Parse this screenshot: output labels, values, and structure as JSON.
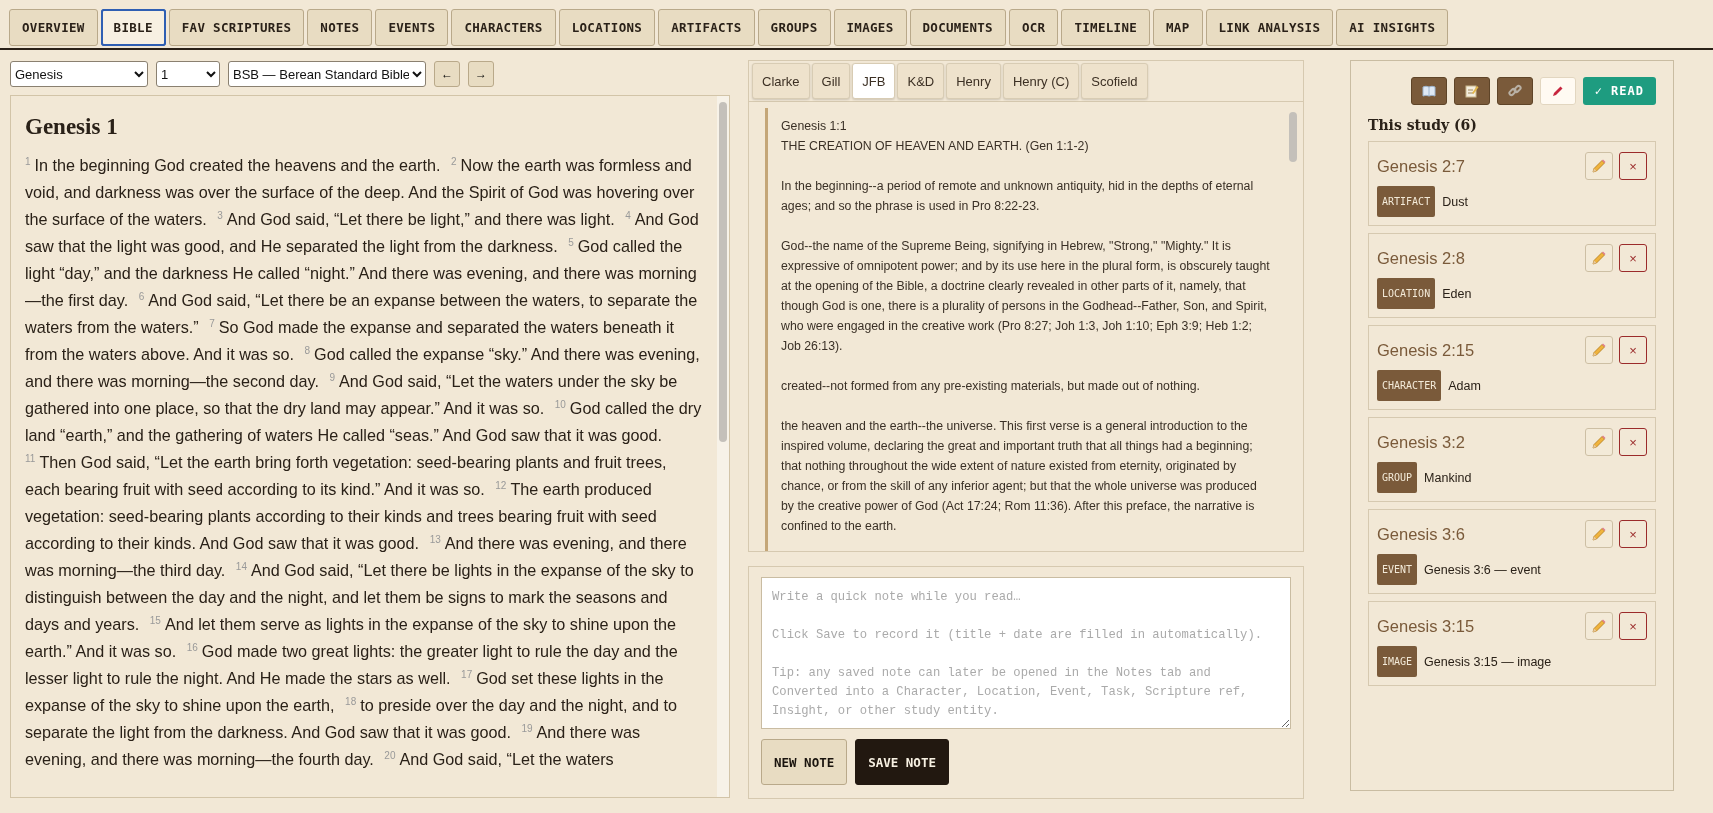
{
  "main_tabs": [
    {
      "label": "OVERVIEW",
      "selected": false
    },
    {
      "label": "BIBLE",
      "selected": true
    },
    {
      "label": "FAV SCRIPTURES",
      "selected": false
    },
    {
      "label": "NOTES",
      "selected": false
    },
    {
      "label": "EVENTS",
      "selected": false
    },
    {
      "label": "CHARACTERS",
      "selected": false
    },
    {
      "label": "LOCATIONS",
      "selected": false
    },
    {
      "label": "ARTIFACTS",
      "selected": false
    },
    {
      "label": "GROUPS",
      "selected": false
    },
    {
      "label": "IMAGES",
      "selected": false
    },
    {
      "label": "DOCUMENTS",
      "selected": false
    },
    {
      "label": "OCR",
      "selected": false
    },
    {
      "label": "TIMELINE",
      "selected": false
    },
    {
      "label": "MAP",
      "selected": false
    },
    {
      "label": "LINK ANALYSIS",
      "selected": false
    },
    {
      "label": "AI INSIGHTS",
      "selected": false
    }
  ],
  "toolbar": {
    "book": "Genesis",
    "chapter": "1",
    "translation": "BSB — Berean Standard Bible",
    "prev_button": "←",
    "next_button": "→"
  },
  "passage": {
    "title": "Genesis 1",
    "verses": [
      {
        "number": "1",
        "text": "In the beginning God created the heavens and the earth."
      },
      {
        "number": "2",
        "text": "Now the earth was formless and void, and darkness was over the surface of the deep. And the Spirit of God was hovering over the surface of the waters."
      },
      {
        "number": "3",
        "text": "And God said, “Let there be light,” and there was light."
      },
      {
        "number": "4",
        "text": "And God saw that the light was good, and He separated the light from the darkness."
      },
      {
        "number": "5",
        "text": "God called the light “day,” and the darkness He called “night.” And there was evening, and there was morning—the first day."
      },
      {
        "number": "6",
        "text": "And God said, “Let there be an expanse between the waters, to separate the waters from the waters.”"
      },
      {
        "number": "7",
        "text": "So God made the expanse and separated the waters beneath it from the waters above. And it was so."
      },
      {
        "number": "8",
        "text": "God called the expanse “sky.” And there was evening, and there was morning—the second day."
      },
      {
        "number": "9",
        "text": "And God said, “Let the waters under the sky be gathered into one place, so that the dry land may appear.” And it was so."
      },
      {
        "number": "10",
        "text": "God called the dry land “earth,” and the gathering of waters He called “seas.” And God saw that it was good."
      },
      {
        "number": "11",
        "text": "Then God said, “Let the earth bring forth vegetation: seed-bearing plants and fruit trees, each bearing fruit with seed according to its kind.” And it was so."
      },
      {
        "number": "12",
        "text": "The earth produced vegetation: seed-bearing plants according to their kinds and trees bearing fruit with seed according to their kinds. And God saw that it was good."
      },
      {
        "number": "13",
        "text": "And there was evening, and there was morning—the third day."
      },
      {
        "number": "14",
        "text": "And God said, “Let there be lights in the expanse of the sky to distinguish between the day and the night, and let them be signs to mark the seasons and days and years."
      },
      {
        "number": "15",
        "text": "And let them serve as lights in the expanse of the sky to shine upon the earth.” And it was so."
      },
      {
        "number": "16",
        "text": "God made two great lights: the greater light to rule the day and the lesser light to rule the night. And He made the stars as well."
      },
      {
        "number": "17",
        "text": "God set these lights in the expanse of the sky to shine upon the earth,"
      },
      {
        "number": "18",
        "text": "to preside over the day and the night, and to separate the light from the darkness. And God saw that it was good."
      },
      {
        "number": "19",
        "text": "And there was evening, and there was morning—the fourth day."
      },
      {
        "number": "20",
        "text": "And God said, “Let the waters"
      }
    ]
  },
  "commentary": {
    "tabs": [
      {
        "label": "Clarke",
        "selected": false
      },
      {
        "label": "Gill",
        "selected": false
      },
      {
        "label": "JFB",
        "selected": true
      },
      {
        "label": "K&D",
        "selected": false
      },
      {
        "label": "Henry",
        "selected": false
      },
      {
        "label": "Henry (C)",
        "selected": false
      },
      {
        "label": "Scofield",
        "selected": false
      }
    ],
    "reference": "Genesis 1:1",
    "heading": "THE CREATION OF HEAVEN AND EARTH. (Gen 1:1-2)",
    "paragraphs": [
      "In the beginning--a period of remote and unknown antiquity, hid in the depths of eternal ages; and so the phrase is used in Pro 8:22-23.",
      "God--the name of the Supreme Being, signifying in Hebrew, \"Strong,\" \"Mighty.\" It is expressive of omnipotent power; and by its use here in the plural form, is obscurely taught at the opening of the Bible, a doctrine clearly revealed in other parts of it, namely, that though God is one, there is a plurality of persons in the Godhead--Father, Son, and Spirit, who were engaged in the creative work (Pro 8:27; Joh 1:3, Joh 1:10; Eph 3:9; Heb 1:2; Job 26:13).",
      "created--not formed from any pre-existing materials, but made out of nothing.",
      "the heaven and the earth--the universe. This first verse is a general introduction to the inspired volume, declaring the great and important truth that all things had a beginning; that nothing throughout the wide extent of nature existed from eternity, originated by chance, or from the skill of any inferior agent; but that the whole universe was produced by the creative power of God (Act 17:24; Rom 11:36). After this preface, the narrative is confined to the earth."
    ]
  },
  "note_editor": {
    "placeholder": "Write a quick note while you read…\n\nClick Save to record it (title + date are filled in automatically).\n\nTip: any saved note can later be opened in the Notes tab and\nConverted into a Character, Location, Event, Task, Scripture ref,\nInsight, or other study entity.",
    "buttons": [
      {
        "label": "NEW NOTE",
        "kind": "secondary"
      },
      {
        "label": "SAVE NOTE",
        "kind": "primary"
      }
    ]
  },
  "study_panel": {
    "actions": [
      {
        "kind": "book"
      },
      {
        "kind": "note"
      },
      {
        "kind": "link"
      },
      {
        "kind": "pen"
      }
    ],
    "read_button": "✓ READ",
    "heading": "This study (6)",
    "items": [
      {
        "reference": "Genesis 2:7",
        "type": "ARTIFACT",
        "label": "Dust",
        "delete": "×"
      },
      {
        "reference": "Genesis 2:8",
        "type": "LOCATION",
        "label": "Eden",
        "delete": "×"
      },
      {
        "reference": "Genesis 2:15",
        "type": "CHARACTER",
        "label": "Adam",
        "delete": "×"
      },
      {
        "reference": "Genesis 3:2",
        "type": "GROUP",
        "label": "Mankind",
        "delete": "×"
      },
      {
        "reference": "Genesis 3:6",
        "type": "EVENT",
        "label": "Genesis 3:6 — event",
        "delete": "×"
      },
      {
        "reference": "Genesis 3:15",
        "type": "IMAGE",
        "label": "Genesis 3:15 — image",
        "delete": "×"
      }
    ]
  }
}
